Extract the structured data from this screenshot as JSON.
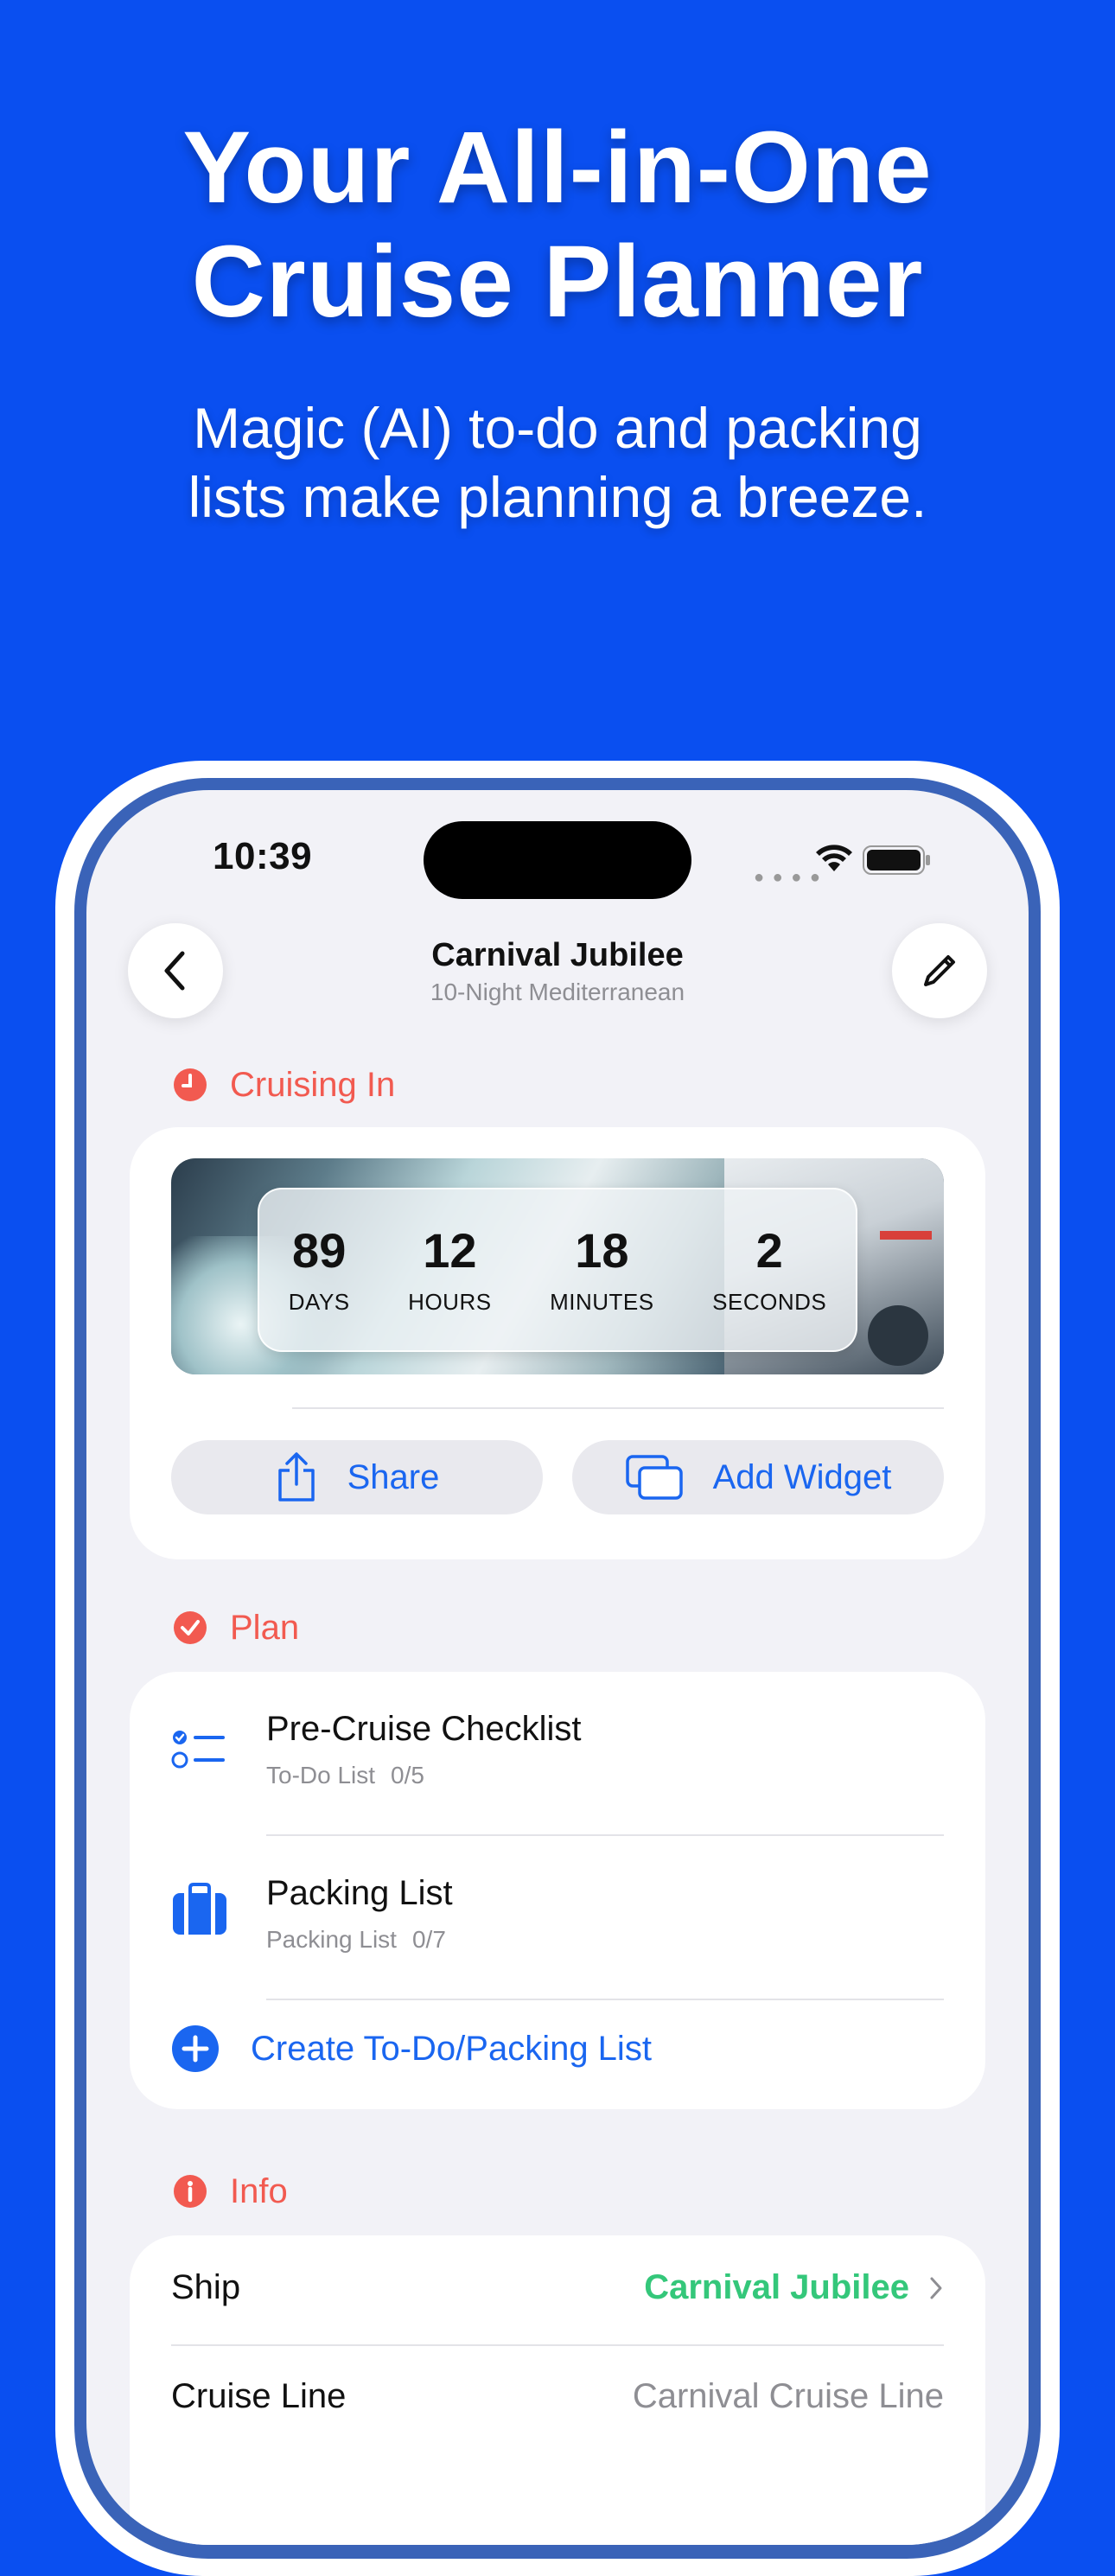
{
  "promo": {
    "headline_line1": "Your All-in-One",
    "headline_line2": "Cruise Planner",
    "subheadline_line1": "Magic (AI) to-do and packing",
    "subheadline_line2": "lists make planning a breeze."
  },
  "status_bar": {
    "time": "10:39"
  },
  "nav": {
    "title": "Carnival Jubilee",
    "subtitle": "10-Night Mediterranean",
    "back_icon": "chevron-left-icon",
    "edit_icon": "pencil-icon"
  },
  "cruising_in": {
    "header": "Cruising In",
    "icon": "clock-icon",
    "countdown": [
      {
        "value": "89",
        "label": "DAYS"
      },
      {
        "value": "12",
        "label": "HOURS"
      },
      {
        "value": "18",
        "label": "MINUTES"
      },
      {
        "value": "2",
        "label": "SECONDS"
      }
    ],
    "share_label": "Share",
    "add_widget_label": "Add Widget"
  },
  "plan": {
    "header": "Plan",
    "icon": "checkmark-circle-icon",
    "items": [
      {
        "title": "Pre-Cruise Checklist",
        "type": "To-Do List",
        "count": "0/5",
        "icon": "checklist-icon"
      },
      {
        "title": "Packing List",
        "type": "Packing List",
        "count": "0/7",
        "icon": "suitcase-icon"
      }
    ],
    "create_label": "Create To-Do/Packing List"
  },
  "info": {
    "header": "Info",
    "icon": "info-circle-icon",
    "rows": [
      {
        "label": "Ship",
        "value": "Carnival Jubilee"
      },
      {
        "label": "Cruise Line",
        "value": "Carnival Cruise Line"
      }
    ]
  },
  "colors": {
    "background": "#0a4ff0",
    "accent_blue": "#1a66f0",
    "section_red": "#f25a50",
    "ship_green": "#34c77a"
  }
}
